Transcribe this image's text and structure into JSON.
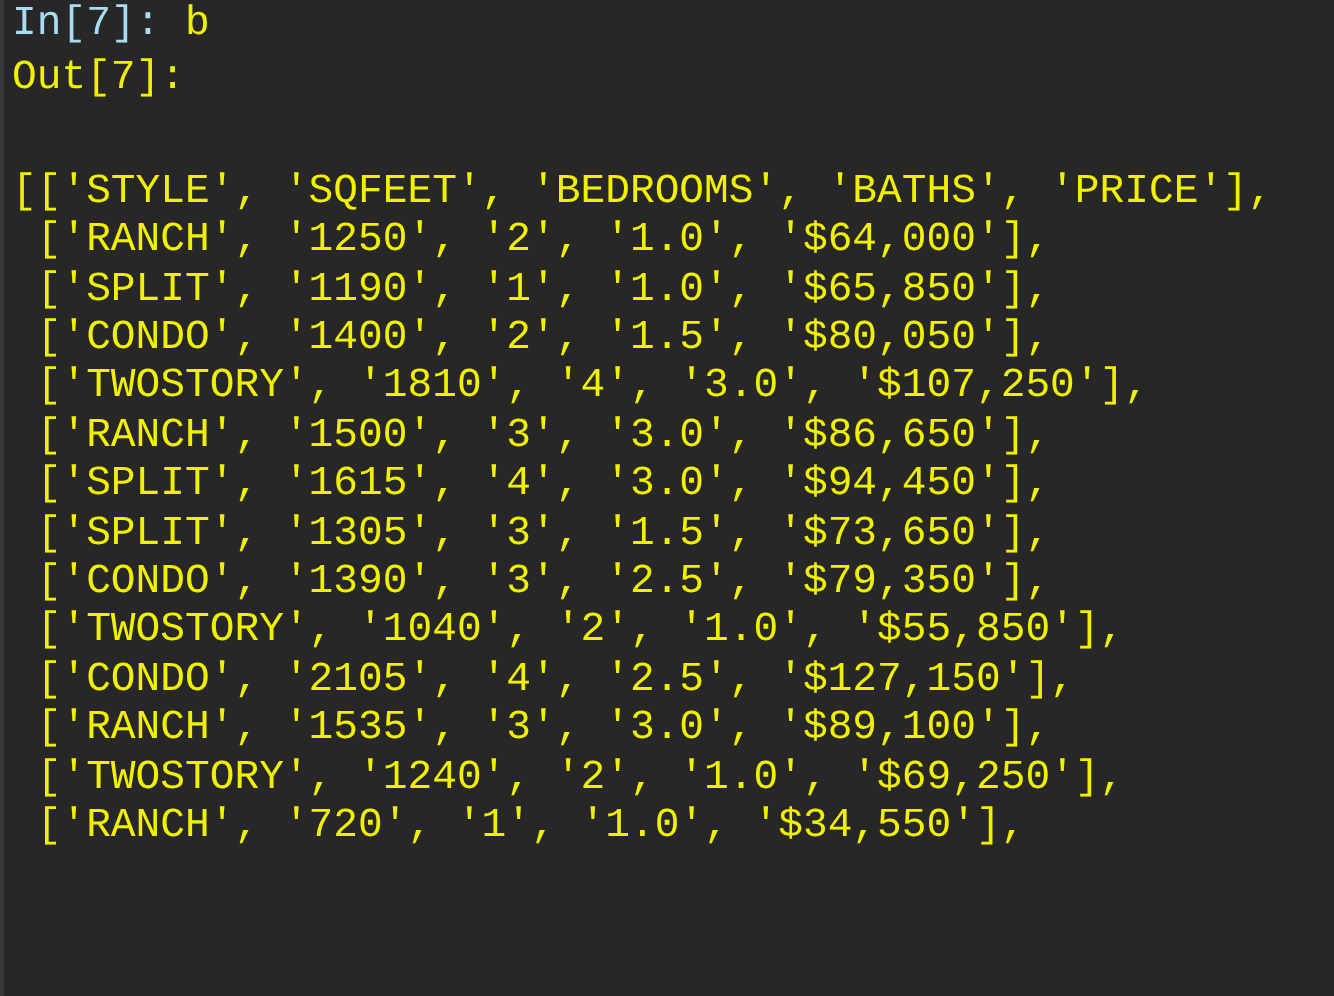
{
  "prompt": {
    "label": "In[7]:",
    "input": "b"
  },
  "output_label": "Out[7]:",
  "output_lines": [
    "[['STYLE', 'SQFEET', 'BEDROOMS', 'BATHS', 'PRICE'],",
    " ['RANCH', '1250', '2', '1.0', '$64,000'],",
    " ['SPLIT', '1190', '1', '1.0', '$65,850'],",
    " ['CONDO', '1400', '2', '1.5', '$80,050'],",
    " ['TWOSTORY', '1810', '4', '3.0', '$107,250'],",
    " ['RANCH', '1500', '3', '3.0', '$86,650'],",
    " ['SPLIT', '1615', '4', '3.0', '$94,450'],",
    " ['SPLIT', '1305', '3', '1.5', '$73,650'],",
    " ['CONDO', '1390', '3', '2.5', '$79,350'],",
    " ['TWOSTORY', '1040', '2', '1.0', '$55,850'],",
    " ['CONDO', '2105', '4', '2.5', '$127,150'],",
    " ['RANCH', '1535', '3', '3.0', '$89,100'],",
    " ['TWOSTORY', '1240', '2', '1.0', '$69,250'],",
    " ['RANCH', '720', '1', '1.0', '$34,550'],"
  ]
}
